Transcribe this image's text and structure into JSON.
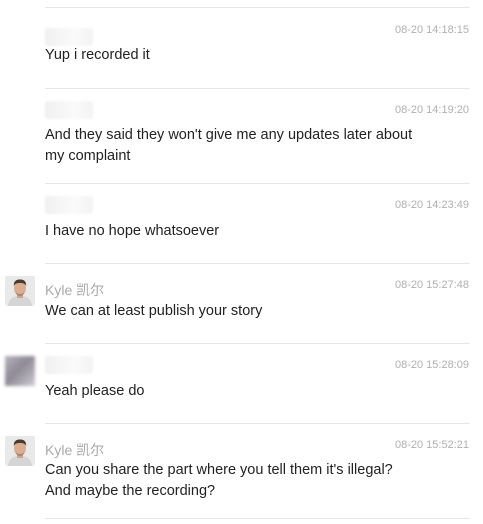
{
  "messages": [
    {
      "sender": "",
      "avatar": "blurred",
      "time": "08-20 14:18:15",
      "text_lines": [
        "Yup i recorded it"
      ]
    },
    {
      "sender": "",
      "avatar": "blurred",
      "time": "08-20 14:19:20",
      "text_lines": [
        "And they said they won't give me any updates later about",
        "my complaint"
      ]
    },
    {
      "sender": "",
      "avatar": "blurred",
      "time": "08-20 14:23:49",
      "text_lines": [
        "I have no hope whatsoever"
      ]
    },
    {
      "sender": "Kyle 凯尔",
      "avatar": "kyle-photo",
      "time": "08-20 15:27:48",
      "text_lines": [
        "We can at least publish your story"
      ]
    },
    {
      "sender": "",
      "avatar": "blurred",
      "time": "08-20 15:28:09",
      "text_lines": [
        "Yeah please do"
      ]
    },
    {
      "sender": "Kyle 凯尔",
      "avatar": "kyle-photo",
      "time": "08-20 15:52:21",
      "text_lines": [
        "Can you share the part where you tell them it's illegal?",
        "And maybe the recording?"
      ]
    }
  ]
}
